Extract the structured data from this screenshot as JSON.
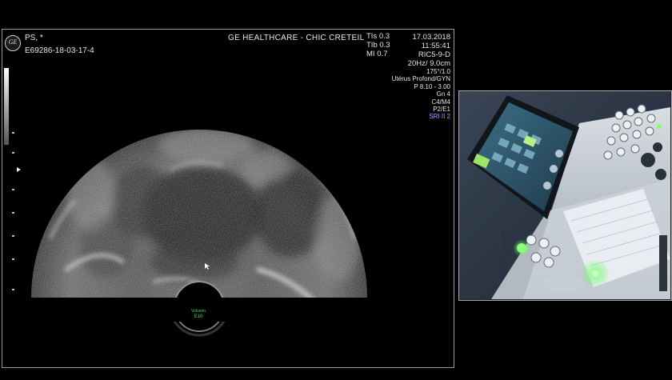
{
  "overlay": {
    "logo_text": "GE",
    "patient_name": "PS,  *",
    "exam_id": "E69286-18-03-17-4",
    "institution": "GE HEALTHCARE - CHIC CRETEIL",
    "tis": "TIs  0.3",
    "tib": "TIb  0.3",
    "mi": "MI   0.7",
    "date": "17.03.2018",
    "time": "11:55:41",
    "probe": "RIC5-9-D",
    "frame_depth": "20Hz/ 9.0cm",
    "angle": "175°/1.0",
    "preset": "Utérus Profond/GYN",
    "power": "P 8.10 - 3.00",
    "gain": "Gn  4",
    "map": "C4/M4",
    "persistence": "P2/E1",
    "sri": "SRI II 2"
  },
  "probe_indicator": {
    "label": "Voluson",
    "model": "E10"
  },
  "colors": {
    "accent_green": "#4fd36a",
    "sri_blue": "#9ea6ff",
    "panel_border": "#9a9a9a"
  }
}
